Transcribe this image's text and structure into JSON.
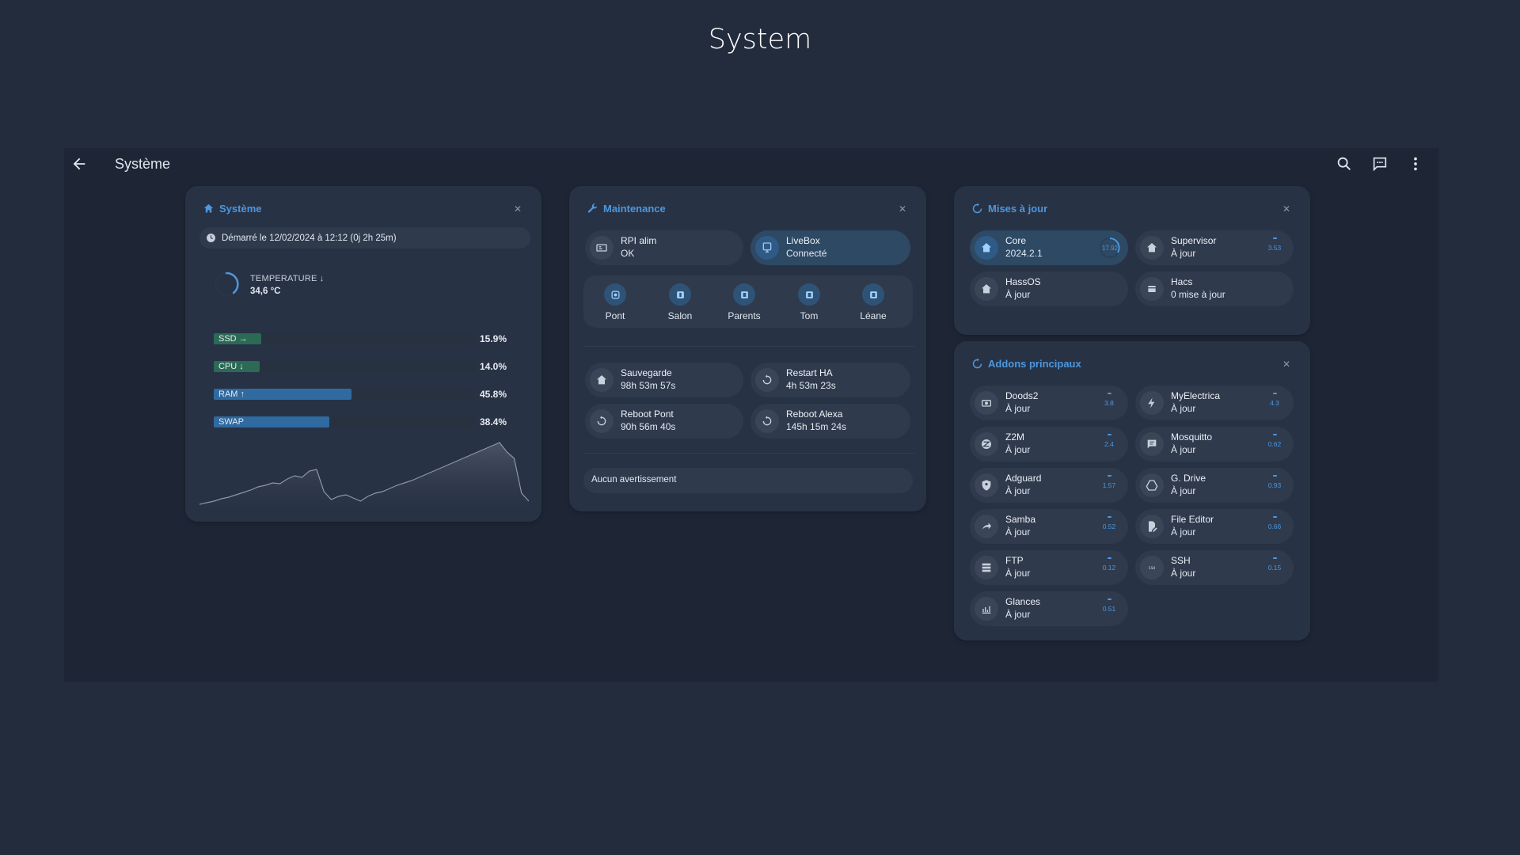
{
  "page": {
    "title": "System"
  },
  "topbar": {
    "title": "Système"
  },
  "colors": {
    "accent": "#4d97de",
    "ssd_fill": "#2b6b55",
    "cpu_fill": "#2b6b55",
    "ram_fill": "#2f6aa0",
    "swap_fill": "#2f6aa0"
  },
  "systeme": {
    "title": "Système",
    "uptime": "Démarré le 12/02/2024 à 12:12 (0j 2h 25m)",
    "temperature_label": "TEMPERATURE ↓",
    "temperature_value": "34,6 °C",
    "bars": [
      {
        "label": "SSD →",
        "value_text": "15.9%",
        "value": 15.9
      },
      {
        "label": "CPU ↓",
        "value_text": "14.0%",
        "value": 14.0
      },
      {
        "label": "RAM ↑",
        "value_text": "45.8%",
        "value": 45.8
      },
      {
        "label": "SWAP",
        "value_text": "38.4%",
        "value": 38.4
      }
    ],
    "history": [
      6,
      8,
      10,
      13,
      15,
      18,
      21,
      24,
      28,
      30,
      33,
      32,
      38,
      42,
      40,
      48,
      50,
      22,
      12,
      16,
      18,
      14,
      10,
      16,
      20,
      22,
      26,
      30,
      33,
      36,
      40,
      44,
      48,
      52,
      56,
      60,
      64,
      68,
      72,
      76,
      80,
      84,
      72,
      64,
      20,
      10
    ]
  },
  "maintenance": {
    "title": "Maintenance",
    "rpi": {
      "name": "RPI alim",
      "state": "OK"
    },
    "livebox": {
      "name": "LiveBox",
      "state": "Connecté"
    },
    "rooms": [
      "Pont",
      "Salon",
      "Parents",
      "Tom",
      "Léane"
    ],
    "actions": [
      {
        "name": "Sauvegarde",
        "state": "98h 53m 57s",
        "icon": "home-sync-icon"
      },
      {
        "name": "Restart HA",
        "state": "4h 53m 23s",
        "icon": "restart-icon"
      },
      {
        "name": "Reboot Pont",
        "state": "90h 56m 40s",
        "icon": "restart-icon"
      },
      {
        "name": "Reboot Alexa",
        "state": "145h 15m 24s",
        "icon": "restart-icon"
      }
    ],
    "warning": "Aucun avertissement"
  },
  "updates": {
    "title": "Mises à jour",
    "items": [
      {
        "name": "Core",
        "state": "2024.2.1",
        "badge": "17.92",
        "icon": "home-assistant-icon"
      },
      {
        "name": "Supervisor",
        "state": "À jour",
        "badge": "3.53",
        "icon": "home-assistant-icon"
      },
      {
        "name": "HassOS",
        "state": "À jour",
        "icon": "home-assistant-icon"
      },
      {
        "name": "Hacs",
        "state": "0 mise à jour",
        "icon": "hacs-icon"
      }
    ]
  },
  "addons": {
    "title": "Addons principaux",
    "items": [
      {
        "name": "Doods2",
        "state": "À jour",
        "badge": "3.8",
        "icon": "camera-icon"
      },
      {
        "name": "MyElectrica",
        "state": "À jour",
        "badge": "4.3",
        "icon": "lightning-icon"
      },
      {
        "name": "Z2M",
        "state": "À jour",
        "badge": "2.4",
        "icon": "zigbee-icon"
      },
      {
        "name": "Mosquitto",
        "state": "À jour",
        "badge": "0.62",
        "icon": "message-icon"
      },
      {
        "name": "Adguard",
        "state": "À jour",
        "badge": "1.57",
        "icon": "shield-icon"
      },
      {
        "name": "G. Drive",
        "state": "À jour",
        "badge": "0.93",
        "icon": "google-drive-icon"
      },
      {
        "name": "Samba",
        "state": "À jour",
        "badge": "0.52",
        "icon": "share-icon"
      },
      {
        "name": "File Editor",
        "state": "À jour",
        "badge": "0.66",
        "icon": "file-edit-icon"
      },
      {
        "name": "FTP",
        "state": "À jour",
        "badge": "0.12",
        "icon": "server-icon"
      },
      {
        "name": "SSH",
        "state": "À jour",
        "badge": "0.15",
        "icon": "ssh-icon"
      },
      {
        "name": "Glances",
        "state": "À jour",
        "badge": "0.51",
        "icon": "chart-bar-icon"
      }
    ]
  }
}
